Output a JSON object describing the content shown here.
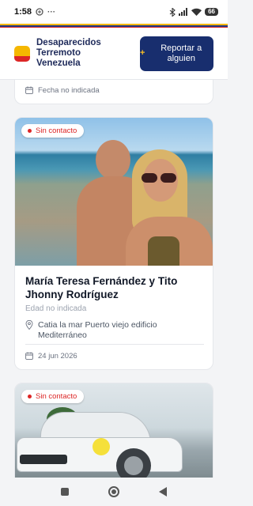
{
  "statusbar": {
    "time": "1:58",
    "battery": "66"
  },
  "header": {
    "brand": "Desaparecidos Terremoto Venezuela",
    "report_label": "Reportar a alguien"
  },
  "cards": [
    {
      "date": "Fecha no indicada"
    },
    {
      "status": "Sin contacto",
      "name": "María Teresa Fernández y Tito Jhonny Rodríguez",
      "age": "Edad no indicada",
      "location": "Catia la mar Puerto viejo edificio Mediterráneo",
      "date": "24 jun 2026"
    },
    {
      "status": "Sin contacto"
    }
  ],
  "colors": {
    "brand_navy": "#182e6e",
    "status_red": "#dc2626",
    "flag_yellow": "#f5b700",
    "flag_blue": "#1e3a8a"
  }
}
